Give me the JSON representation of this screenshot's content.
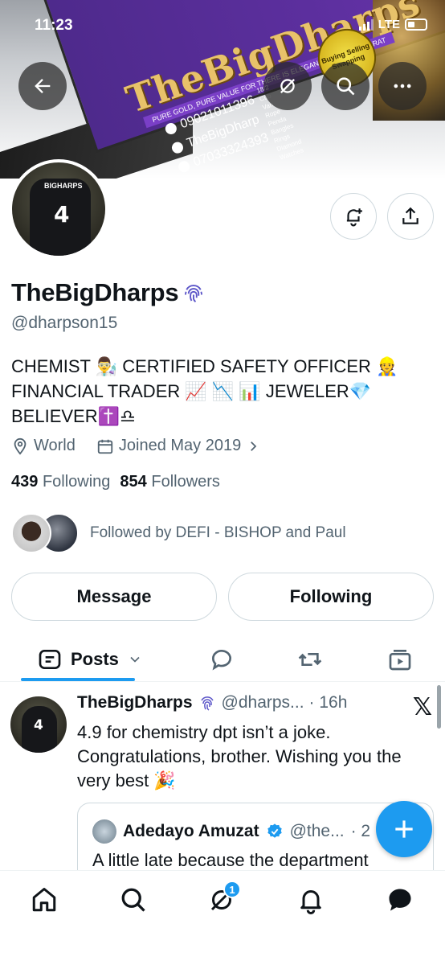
{
  "status_bar": {
    "time": "11:23",
    "network": "LTE"
  },
  "banner": {
    "brand": "TheBigDharps",
    "strip": "PURE GOLD, PURE VALUE FOR THERE IS ELEGANCE IN EVERY KARAT",
    "phone_1": "09021011396",
    "account": "TheBigDharp",
    "phone_2": "07033324393",
    "items": [
      "18/2",
      "Cub",
      "Van",
      "Rope",
      "Penda",
      "Bangles",
      "Rings",
      "Diamond",
      "Watches"
    ],
    "badge": "Buying Selling Swapping"
  },
  "profile": {
    "name": "TheBigDharps",
    "handle": "@dharpson15",
    "bio_line_1": "CHEMIST 👨‍🔬 CERTIFIED SAFETY OFFICER 👷",
    "bio_line_2": "FINANCIAL TRADER 📈 📉 📊 JEWELER💎",
    "bio_line_3": "BELIEVER✝️♎",
    "location": "World",
    "joined": "Joined May 2019",
    "following_count": "439",
    "following_label": "Following",
    "followers_count": "854",
    "followers_label": "Followers",
    "followed_by": "Followed by DEFI - BISHOP and Paul"
  },
  "actions": {
    "message": "Message",
    "following": "Following"
  },
  "tabs": {
    "posts": "Posts"
  },
  "tweet": {
    "name": "TheBigDharps",
    "handle": "@dharps...",
    "time": "· 16h",
    "text": "4.9 for chemistry dpt isn’t a joke. Congratulations, brother. Wishing you the very best 🎉",
    "quote": {
      "name": "Adedayo Amuzat",
      "handle": "@the...",
      "time": "· 2",
      "text": "A little late because the department"
    }
  },
  "nav": {
    "notification_count": "1"
  },
  "colors": {
    "accent": "#1d9bf0",
    "text": "#0f1419",
    "muted": "#536471"
  }
}
